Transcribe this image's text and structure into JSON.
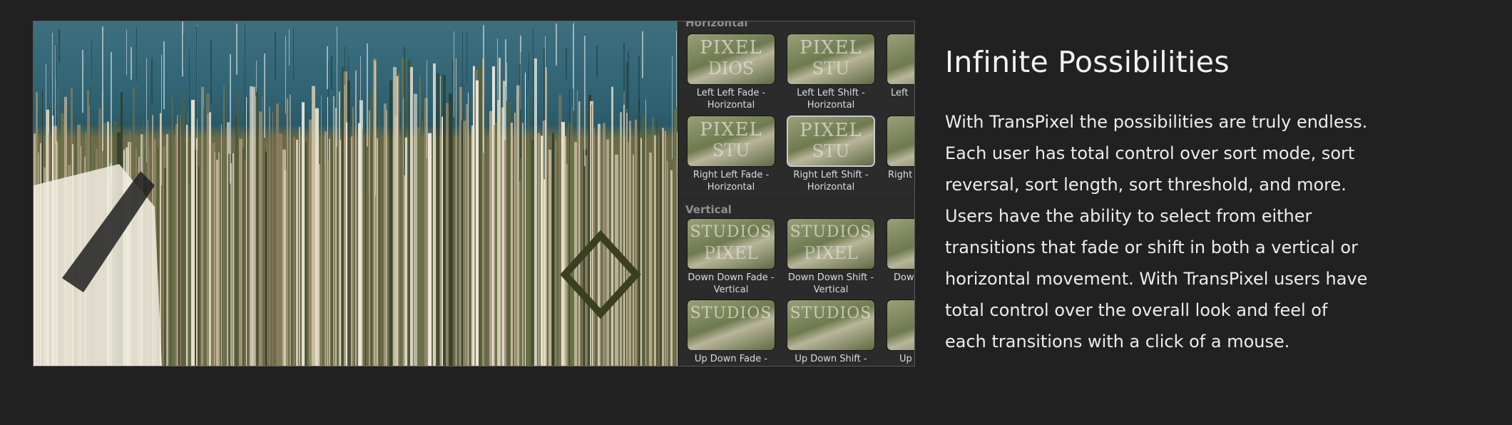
{
  "feature": {
    "title": "Infinite Possibilities",
    "body": "With TransPixel the possibilities are truly endless. Each user has total control over sort mode, sort reversal, sort length, sort threshold, and more. Users have the ability to select from either transitions that fade or shift in both a vertical or horizontal movement. With TransPixel users have total control over the overall look and feel of each transitions with a click of a mouse."
  },
  "browser": {
    "sections": [
      {
        "label": "Horizontal"
      },
      {
        "label": "Vertical"
      }
    ],
    "thumbnails": [
      {
        "caption": "Left Left Fade - Horizontal",
        "overlay_top": "PIXEL",
        "overlay_bottom": "DIOS",
        "selected": false
      },
      {
        "caption": "Left Left Shift - Horizontal",
        "overlay_top": "PIXEL",
        "overlay_bottom": "STU",
        "selected": false
      },
      {
        "caption": "Left",
        "overlay_top": "",
        "overlay_bottom": "",
        "selected": false
      },
      {
        "caption": "Right Left Fade - Horizontal",
        "overlay_top": "PIXEL",
        "overlay_bottom": "STU",
        "selected": false
      },
      {
        "caption": "Right Left Shift - Horizontal",
        "overlay_top": "PIXEL",
        "overlay_bottom": "STU",
        "selected": true
      },
      {
        "caption": "Right",
        "overlay_top": "",
        "overlay_bottom": "",
        "selected": false
      },
      {
        "caption": "Down Down Fade - Vertical",
        "overlay_top": "STUDIOS",
        "overlay_bottom": "PIXEL",
        "selected": false
      },
      {
        "caption": "Down Down Shift - Vertical",
        "overlay_top": "STUDIOS",
        "overlay_bottom": "PIXEL",
        "selected": false
      },
      {
        "caption": "Dow",
        "overlay_top": "",
        "overlay_bottom": "",
        "selected": false
      },
      {
        "caption": "Up Down Fade -",
        "overlay_top": "STUDIOS",
        "overlay_bottom": "",
        "selected": false
      },
      {
        "caption": "Up Down Shift -",
        "overlay_top": "STUDIOS",
        "overlay_bottom": "",
        "selected": false
      },
      {
        "caption": "Up",
        "overlay_top": "",
        "overlay_bottom": "",
        "selected": false
      }
    ]
  }
}
